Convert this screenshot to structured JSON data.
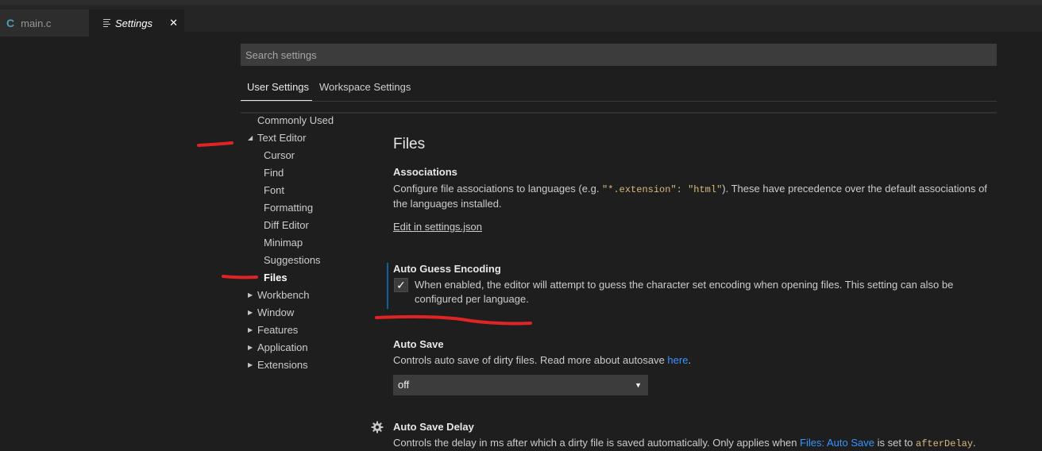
{
  "tabs": [
    {
      "label": "main.c",
      "icon": "c-file-icon"
    },
    {
      "label": "Settings",
      "icon": "settings-lines-icon"
    }
  ],
  "search": {
    "placeholder": "Search settings"
  },
  "scope_tabs": [
    "User Settings",
    "Workspace Settings"
  ],
  "toc": {
    "commonly_used": "Commonly Used",
    "text_editor": "Text Editor",
    "children": [
      "Cursor",
      "Find",
      "Font",
      "Formatting",
      "Diff Editor",
      "Minimap",
      "Suggestions",
      "Files"
    ],
    "groups": [
      "Workbench",
      "Window",
      "Features",
      "Application",
      "Extensions"
    ]
  },
  "section_title": "Files",
  "associations": {
    "title": "Associations",
    "desc_pre": "Configure file associations to languages (e.g. ",
    "code": "\"*.extension\": \"html\"",
    "desc_post": "). These have precedence over the default associations of the languages installed.",
    "edit_link": "Edit in settings.json"
  },
  "auto_guess": {
    "title": "Auto Guess Encoding",
    "checked": "✓",
    "desc": "When enabled, the editor will attempt to guess the character set encoding when opening files. This setting can also be configured per language."
  },
  "auto_save": {
    "title": "Auto Save",
    "desc": "Controls auto save of dirty files. Read more about autosave ",
    "link": "here",
    "period": ".",
    "value": "off"
  },
  "auto_save_delay": {
    "title": "Auto Save Delay",
    "desc_pre": "Controls the delay in ms after which a dirty file is saved automatically. Only applies when ",
    "link": "Files: Auto Save",
    "desc_mid": " is set to ",
    "code": "afterDelay",
    "period": "."
  },
  "colors": {
    "accent": "#0e639c",
    "link": "#3794ff",
    "annotation": "#e02424"
  }
}
